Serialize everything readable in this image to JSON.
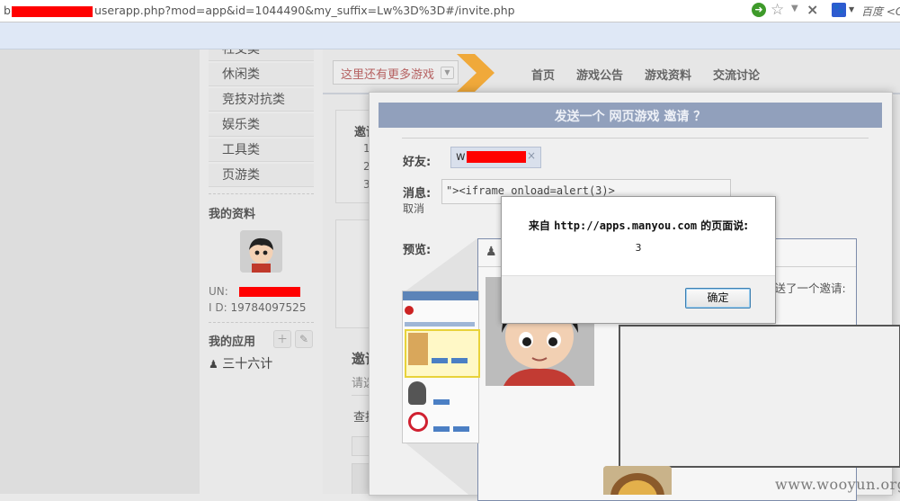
{
  "browser": {
    "url_suffix": "userapp.php?mod=app&id=1044490&my_suffix=Lw%3D%3D#/invite.php",
    "url_prefix_visible": "b",
    "search_engine_label": "百度 <G"
  },
  "sidebar": {
    "categories": [
      "社交类",
      "休闲类",
      "竞技对抗类",
      "娱乐类",
      "工具类",
      "页游类"
    ],
    "profile_title": "我的资料",
    "un_label": "UN:",
    "id_label": "I D:",
    "id_value": "19784097525",
    "apps_title": "我的应用",
    "app_name": "三十六计"
  },
  "main": {
    "game_select": "这里还有更多游戏",
    "nav": [
      "首页",
      "游戏公告",
      "游戏资料",
      "交流讨论"
    ],
    "invite_panel_heading": "邀请",
    "invite_list": [
      "1、",
      "2、",
      "3、"
    ],
    "lower_heading": "邀请",
    "lower_text": "请选",
    "lower_search": "查找"
  },
  "dialog": {
    "title": "发送一个 网页游戏 邀请 ？",
    "friend_label": "好友:",
    "friend_name_visible": "w",
    "friend_remove": "×",
    "message_label": "消息:",
    "message_value": "\"><iframe onload=alert(3)>",
    "cancel": "取消",
    "preview_label": "预览:",
    "preview_message": "发送了一个邀请:"
  },
  "alert": {
    "message_prefix": "来自",
    "message_url": "http://apps.manyou.com",
    "message_suffix": "的页面说:",
    "value": "3",
    "ok_label": "确定"
  },
  "watermark": "www.wooyun.org",
  "colors": {
    "redaction": "#ff0000",
    "dialog_title_bar": "#91a0bc",
    "nav_arrow": "#f0a93a"
  }
}
